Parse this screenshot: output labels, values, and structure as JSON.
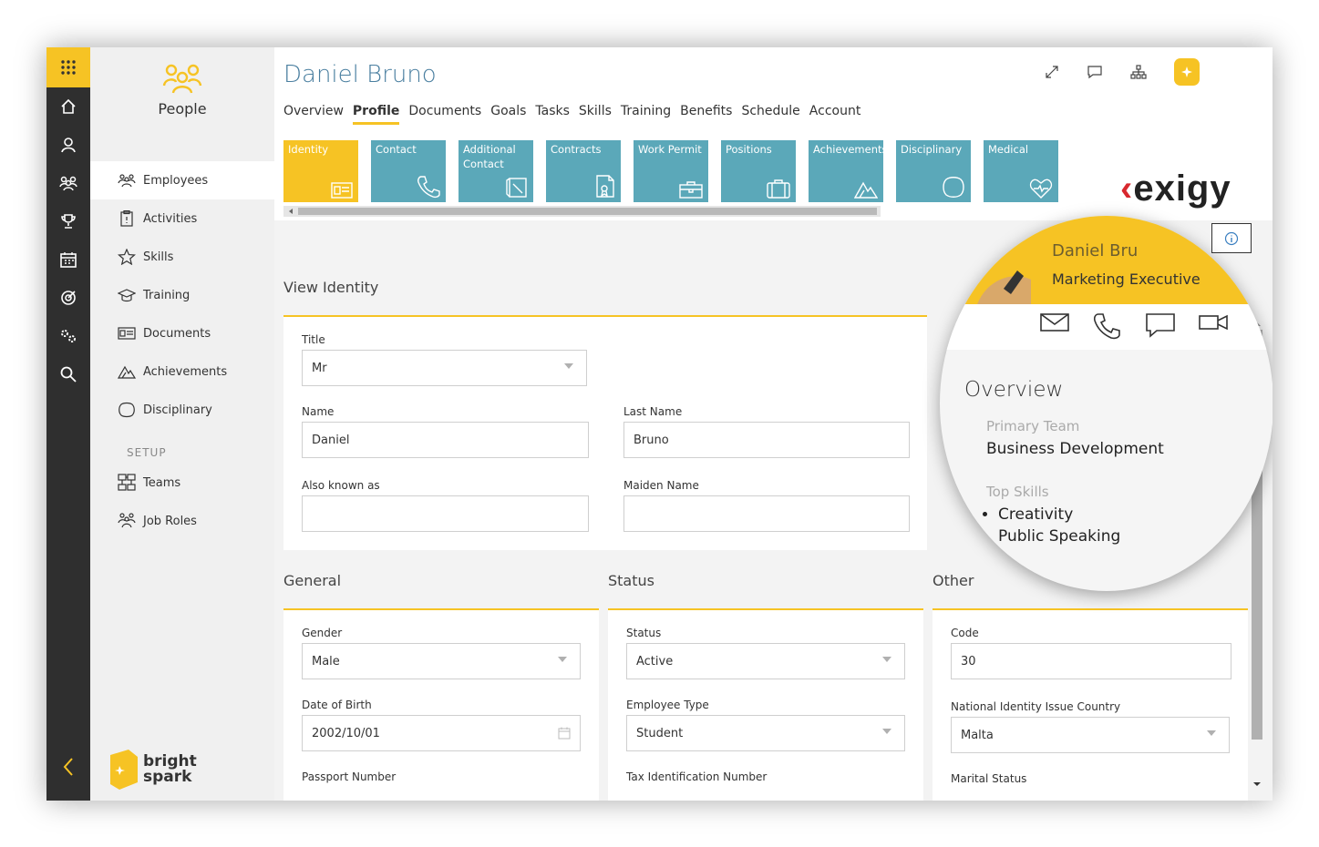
{
  "app": {
    "module": "People",
    "brand_bottom": "bright\nspark"
  },
  "colors": {
    "accent": "#f6c324",
    "tile": "#5ba8b9",
    "rail": "#2f2f2f"
  },
  "nav": {
    "items": [
      {
        "label": "Employees",
        "icon": "employees-icon"
      },
      {
        "label": "Activities",
        "icon": "activities-icon"
      },
      {
        "label": "Skills",
        "icon": "star-icon"
      },
      {
        "label": "Training",
        "icon": "graduation-cap-icon"
      },
      {
        "label": "Documents",
        "icon": "id-card-icon"
      },
      {
        "label": "Achievements",
        "icon": "mountain-icon"
      },
      {
        "label": "Disciplinary",
        "icon": "badge-icon"
      }
    ],
    "setup_label": "SETUP",
    "setup_items": [
      {
        "label": "Teams",
        "icon": "teams-icon"
      },
      {
        "label": "Job Roles",
        "icon": "job-roles-icon"
      }
    ]
  },
  "header": {
    "title": "Daniel Bruno",
    "tabs": [
      "Overview",
      "Profile",
      "Documents",
      "Goals",
      "Tasks",
      "Skills",
      "Training",
      "Benefits",
      "Schedule",
      "Account"
    ],
    "active_tab": "Profile",
    "tiles": [
      {
        "label": "Identity",
        "icon": "id-card-icon"
      },
      {
        "label": "Contact",
        "icon": "phone-icon"
      },
      {
        "label": "Additional Contact",
        "icon": "contact-book-icon"
      },
      {
        "label": "Contracts",
        "icon": "contract-icon"
      },
      {
        "label": "Work Permit",
        "icon": "briefcase-icon"
      },
      {
        "label": "Positions",
        "icon": "suitcase-icon"
      },
      {
        "label": "Achievements",
        "icon": "mountain-icon"
      },
      {
        "label": "Disciplinary",
        "icon": "badge-icon"
      },
      {
        "label": "Medical",
        "icon": "heart-pulse-icon"
      }
    ],
    "logo_text": "exigy"
  },
  "identity": {
    "section_title": "View Identity",
    "title_label": "Title",
    "title_value": "Mr",
    "name_label": "Name",
    "name_value": "Daniel",
    "last_name_label": "Last Name",
    "last_name_value": "Bruno",
    "aka_label": "Also known as",
    "aka_value": "",
    "maiden_label": "Maiden Name",
    "maiden_value": ""
  },
  "general": {
    "section_title": "General",
    "gender_label": "Gender",
    "gender_value": "Male",
    "dob_label": "Date of Birth",
    "dob_value": "2002/10/01",
    "passport_label": "Passport Number"
  },
  "status": {
    "section_title": "Status",
    "status_label": "Status",
    "status_value": "Active",
    "emp_type_label": "Employee Type",
    "emp_type_value": "Student",
    "tax_label": "Tax Identification Number"
  },
  "other": {
    "section_title": "Other",
    "code_label": "Code",
    "code_value": "30",
    "nat_country_label": "National Identity Issue Country",
    "nat_country_value": "Malta",
    "marital_label": "Marital Status"
  },
  "magnifier": {
    "name_partial": "Daniel Bru",
    "role": "Marketing Executive",
    "heading": "Overview",
    "primary_team_label": "Primary Team",
    "primary_team_value": "Business Development",
    "top_skills_label": "Top Skills",
    "top_skills": [
      "Creativity",
      "Public Speaking"
    ]
  }
}
